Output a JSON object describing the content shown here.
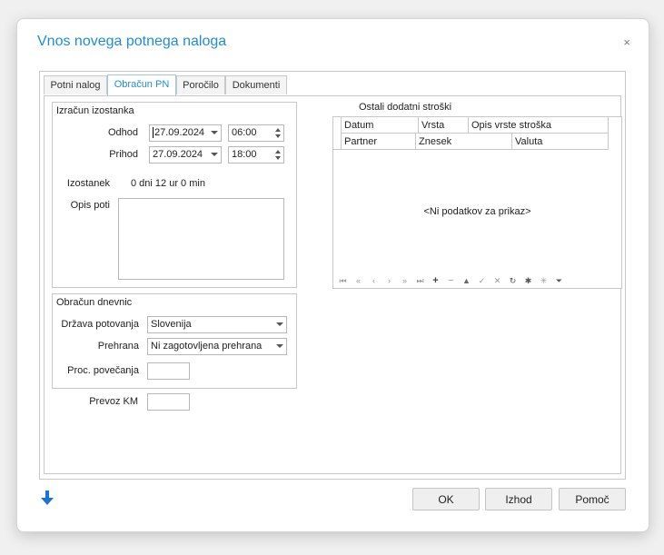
{
  "dialog": {
    "title": "Vnos novega potnega naloga",
    "close_glyph": "×"
  },
  "tabs": [
    {
      "label": "Potni nalog",
      "active": false
    },
    {
      "label": "Obračun PN",
      "active": true
    },
    {
      "label": "Poročilo",
      "active": false
    },
    {
      "label": "Dokumenti",
      "active": false
    }
  ],
  "izracun": {
    "group_label": "Izračun izostanka",
    "odhod_label": "Odhod",
    "odhod_date": "27.09.2024",
    "odhod_time": "06:00",
    "prihod_label": "Prihod",
    "prihod_date": "27.09.2024",
    "prihod_time": "18:00",
    "izostanek_label": "Izostanek",
    "izostanek_value": "0 dni 12 ur 0 min",
    "opis_label": "Opis poti",
    "opis_value": ""
  },
  "dnevnice": {
    "group_label": "Obračun dnevnic",
    "drzava_label": "Država potovanja",
    "drzava_value": "Slovenija",
    "prehrana_label": "Prehrana",
    "prehrana_value": "Ni zagotovljena prehrana",
    "povecanja_label": "Proc. povečanja",
    "povecanja_value": ""
  },
  "prevoz": {
    "label": "Prevoz KM",
    "value": ""
  },
  "stroski": {
    "title": "Ostali dodatni stroški",
    "columns_row1": [
      "Datum",
      "Vrsta",
      "Opis vrste stroška"
    ],
    "columns_row2": [
      "Partner",
      "Znesek",
      "Valuta"
    ],
    "empty_text": "<Ni podatkov za prikaz>",
    "nav_icons": [
      "first-icon",
      "prev-page-icon",
      "prev-icon",
      "next-icon",
      "next-page-icon",
      "last-icon",
      "append-icon",
      "delete-icon",
      "edit-icon",
      "save-icon",
      "cancel-icon",
      "refresh-icon",
      "bookmark-icon",
      "goto-bookmark-icon",
      "filter-icon"
    ]
  },
  "buttons": {
    "ok": "OK",
    "izhod": "Izhod",
    "pomoc": "Pomoč"
  },
  "colors": {
    "accent": "#1f8dd6",
    "icon_blue": "#1b74d1"
  }
}
